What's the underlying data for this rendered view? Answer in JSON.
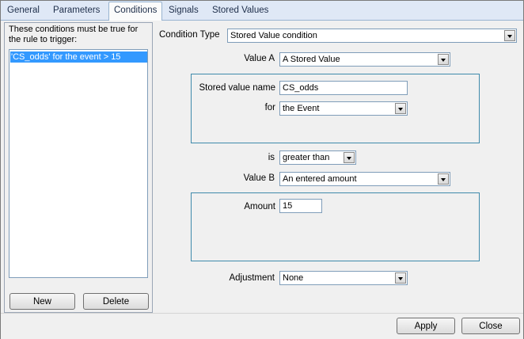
{
  "tabs": [
    {
      "label": "General"
    },
    {
      "label": "Parameters"
    },
    {
      "label": "Conditions"
    },
    {
      "label": "Signals"
    },
    {
      "label": "Stored Values"
    }
  ],
  "conditions_panel": {
    "legend": "These conditions must be true for the rule to trigger:",
    "items": [
      "'CS_odds' for the event > 15"
    ],
    "new_label": "New",
    "delete_label": "Delete"
  },
  "form": {
    "condition_type_label": "Condition Type",
    "condition_type_value": "Stored Value condition",
    "value_a_label": "Value A",
    "value_a_value": "A Stored Value",
    "stored_value_name_label": "Stored value name",
    "stored_value_name_value": "CS_odds",
    "for_label": "for",
    "for_value": "the Event",
    "is_label": "is",
    "is_value": "greater than",
    "value_b_label": "Value B",
    "value_b_value": "An entered amount",
    "amount_label": "Amount",
    "amount_value": "15",
    "adjustment_label": "Adjustment",
    "adjustment_value": "None"
  },
  "footer": {
    "apply_label": "Apply",
    "close_label": "Close"
  }
}
